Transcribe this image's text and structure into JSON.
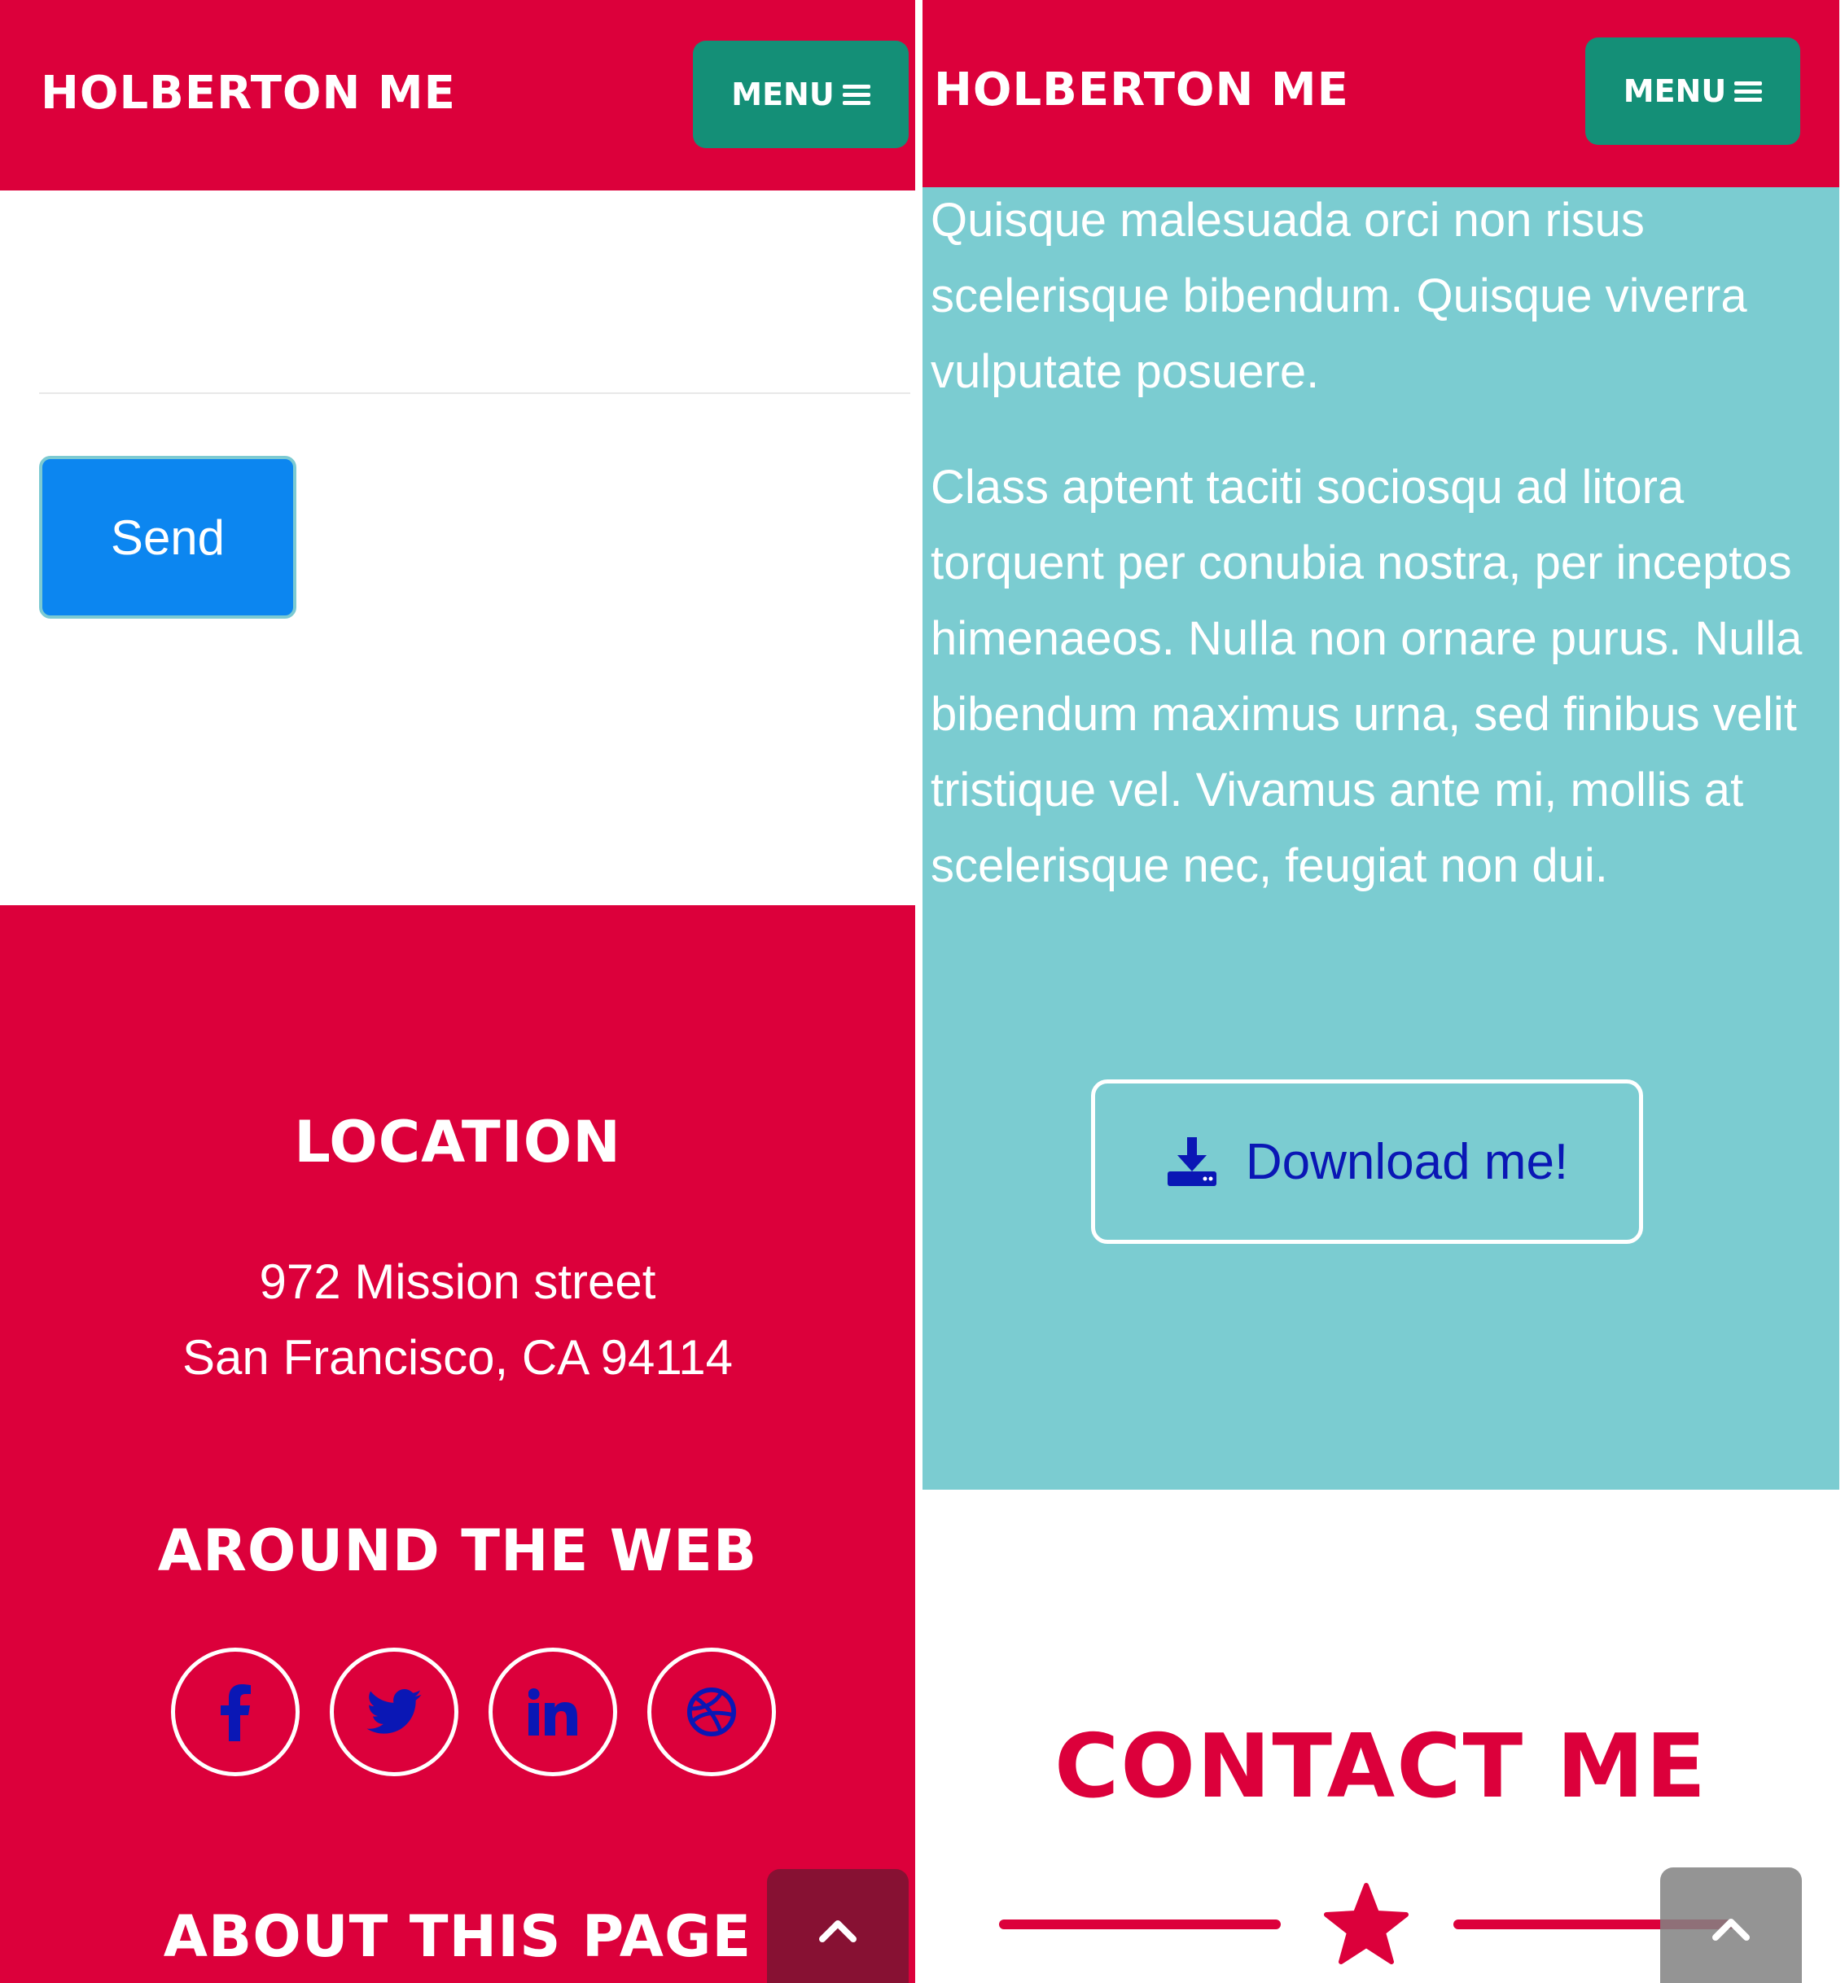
{
  "colors": {
    "brand_red": "#dc003b",
    "menu_teal": "#148f77",
    "section_teal": "#7bccd1",
    "send_blue": "#0c86f0",
    "icon_blue": "#0a17b5",
    "scroll_dark": "#871133",
    "scroll_gray": "#8f8f8f"
  },
  "left": {
    "navbar": {
      "brand": "HOLBERTON ME",
      "menu_label": "MENU",
      "menu_icon": "bars-icon"
    },
    "form": {
      "send_label": "Send"
    },
    "footer": {
      "location_title": "LOCATION",
      "address_line1": "972 Mission street",
      "address_line2": "San Francisco, CA 94114",
      "web_title": "AROUND THE WEB",
      "social": [
        "facebook-icon",
        "twitter-icon",
        "linkedin-icon",
        "dribbble-icon"
      ],
      "about_title": "ABOUT THIS PAGE"
    },
    "scroll_top_icon": "chevron-up-icon"
  },
  "right": {
    "navbar": {
      "brand": "HOLBERTON ME",
      "menu_label": "MENU",
      "menu_icon": "bars-icon"
    },
    "about": {
      "paragraph1": "Quisque malesuada orci non risus scelerisque bibendum. Quisque viverra vulputate posuere.",
      "paragraph2": "Class aptent taciti sociosqu ad litora torquent per conubia nostra, per inceptos himenaeos. Nulla non ornare purus. Nulla bibendum maximus urna, sed finibus velit tristique vel. Vivamus ante mi, mollis at scelerisque nec, feugiat non dui.",
      "download_label": "Download me!",
      "download_icon": "download-icon"
    },
    "contact": {
      "title": "CONTACT ME",
      "divider_icon": "star-icon"
    },
    "scroll_top_icon": "chevron-up-icon"
  }
}
